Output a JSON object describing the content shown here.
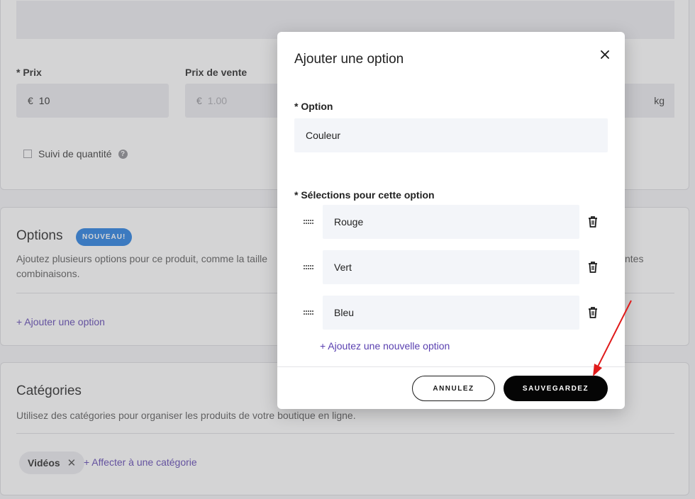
{
  "background": {
    "pricing": {
      "price_label": "* Prix",
      "price_currency": "€",
      "price_value": "10",
      "sale_price_label": "Prix de vente",
      "sale_price_currency": "€",
      "sale_price_placeholder": "1.00",
      "weight_unit": "kg",
      "track_quantity_label": "Suivi de quantité",
      "help_glyph": "?"
    },
    "options_card": {
      "title": "Options",
      "badge": "NOUVEAU!",
      "description_line1": "Ajoutez plusieurs options pour ce produit, comme la taille",
      "description_line1_tail": "ntes",
      "description_line2": "combinaisons.",
      "add_option_link": "+ Ajouter une option"
    },
    "categories_card": {
      "title": "Catégories",
      "description": "Utilisez des catégories pour organiser les produits de votre boutique en ligne.",
      "tag_label": "Vidéos",
      "tag_remove": "✕",
      "assign_link": "+ Affecter à une catégorie"
    }
  },
  "modal": {
    "title": "Ajouter une option",
    "option_label": "* Option",
    "option_value": "Couleur",
    "selections_label": "* Sélections pour cette option",
    "selections": [
      {
        "value": "Rouge"
      },
      {
        "value": "Vert"
      },
      {
        "value": "Bleu"
      }
    ],
    "add_selection_link": "+ Ajoutez une nouvelle option",
    "cancel_label": "ANNULEZ",
    "save_label": "SAUVEGARDEZ"
  },
  "colors": {
    "accent_link": "#5a40b0",
    "badge_blue": "#1f7be0",
    "save_button": "#050505",
    "annotation_arrow": "#e01b1b"
  },
  "icons": {
    "close": "close-icon",
    "trash": "trash-icon",
    "drag": "drag-handle-icon",
    "help": "help-icon",
    "arrow": "annotation-arrow"
  }
}
